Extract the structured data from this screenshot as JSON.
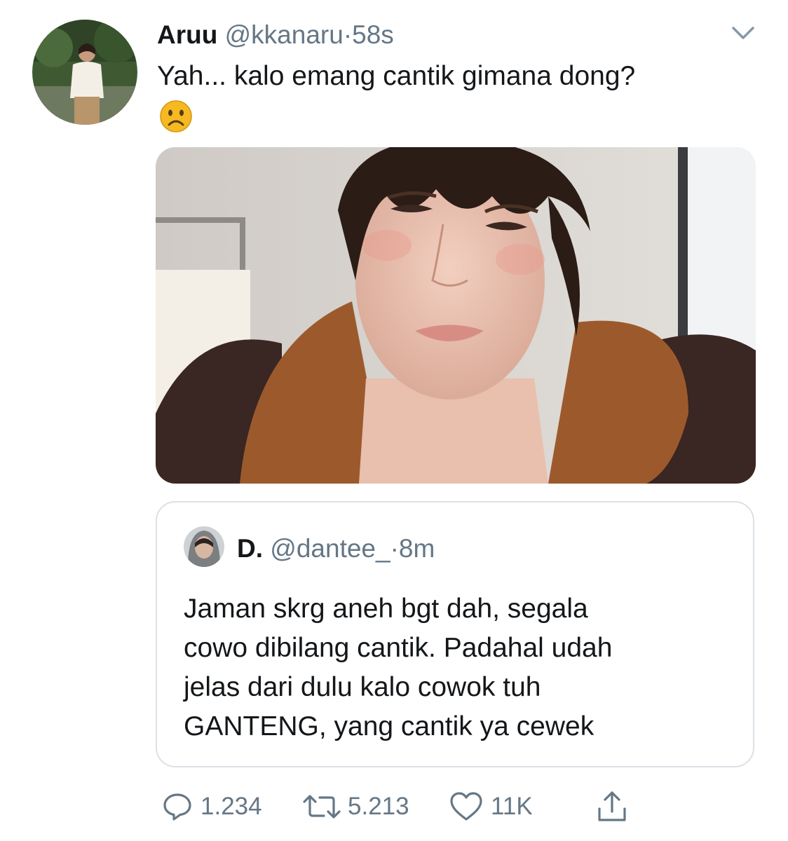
{
  "tweet": {
    "author_name": "Aruu",
    "handle": "@kkanaru",
    "separator": "·",
    "time": "58s",
    "text": "Yah... kalo emang cantik gimana dong?",
    "emoji": "frowning-face-emoji"
  },
  "quoted_tweet": {
    "author_name": "D.",
    "handle": "@dantee_",
    "separator": "·",
    "time": "8m",
    "text_lines": [
      "Jaman skrg aneh bgt dah, segala",
      "cowo dibilang cantik. Padahal udah",
      "jelas dari dulu kalo cowok tuh",
      "GANTENG, yang cantik ya cewek"
    ]
  },
  "actions": {
    "reply": {
      "icon": "reply-icon",
      "count": "1.234"
    },
    "retweet": {
      "icon": "retweet-icon",
      "count": "5.213"
    },
    "like": {
      "icon": "heart-icon",
      "count": "11K"
    },
    "share": {
      "icon": "share-icon"
    }
  },
  "colors": {
    "text": "#14171a",
    "secondary": "#657786",
    "border": "#dbe1e6",
    "emoji_yellow": "#f5b922"
  }
}
